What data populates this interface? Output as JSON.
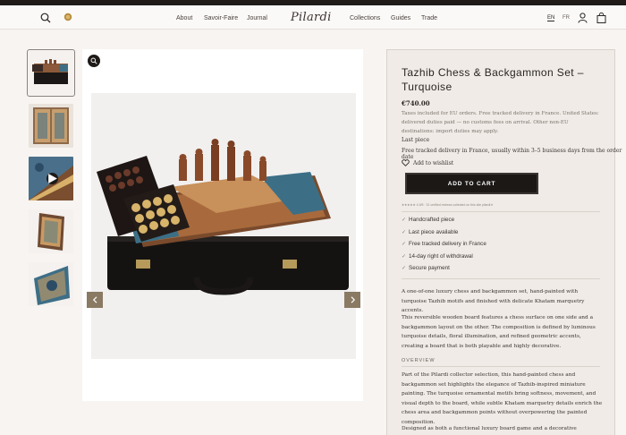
{
  "header": {
    "brand": "Pilardi",
    "nav_left": [
      "About",
      "Savoir-Faire",
      "Journal"
    ],
    "nav_right": [
      "Collections",
      "Guides",
      "Trade"
    ],
    "lang_active": "EN",
    "lang_other": "FR",
    "icons": [
      "search-icon",
      "gold-badge-icon",
      "user-icon",
      "bag-icon"
    ]
  },
  "gallery": {
    "thumbnail_count": 5,
    "selected_index": 0,
    "video_thumb_index": 2
  },
  "product": {
    "title": "Tazhib Chess & Backgammon Set – Turquoise",
    "price": "€740.00",
    "tax_note": "Taxes included for EU orders. Free tracked delivery in France. United States: delivered duties paid — no customs fees on arrival. Other non-EU destinations: import duties may apply.",
    "stock": "Last piece",
    "delivery": "Free tracked delivery in France, usually within 3–5 business days from the order date",
    "wishlist": "Add to wishlist",
    "add_to_cart": "ADD TO CART",
    "reviews_line": "★★★★★ 4.9/5 · 31 verified reviews collected on this site pilardi.fr",
    "features": [
      "Handcrafted piece",
      "Last piece available",
      "Free tracked delivery in France",
      "14-day right of withdrawal",
      "Secure payment"
    ],
    "intro": "A one-of-one luxury chess and backgammon set, hand-painted with turquoise Tazhib motifs and finished with delicate Khatam marquetry accents.",
    "description": "This reversible wooden board features a chess surface on one side and a backgammon layout on the other. The composition is defined by luminous turquoise details, floral illumination, and refined geometric accents, creating a board that is both playable and highly decorative.",
    "overview_heading": "OVERVIEW",
    "overview": "Part of the Pilardi collector selection, this hand-painted chess and backgammon set highlights the elegance of Tazhib-inspired miniature painting. The turquoise ornamental motifs bring softness, movement, and visual depth to the board, while subtle Khatam marquetry details enrich the chess area and backgammon points without overpowering the painted composition.",
    "closing": "Designed as both a functional luxury board game and a decorative collector's"
  },
  "colors": {
    "accent": "#1b1816",
    "panel": "#f0ebe6",
    "arrow": "#8a7a63"
  }
}
